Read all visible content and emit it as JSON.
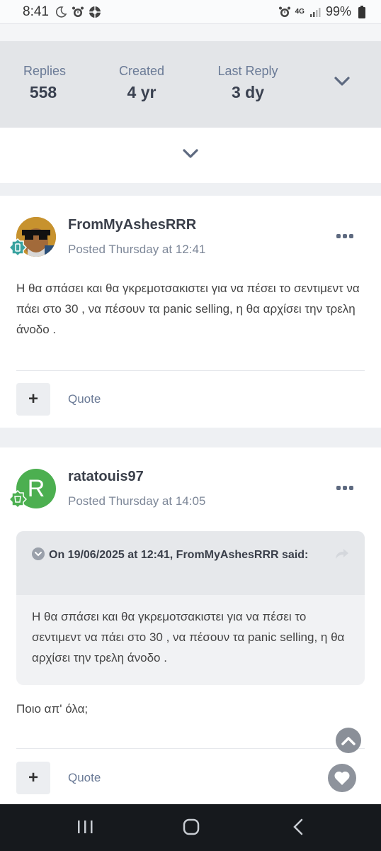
{
  "status_bar": {
    "time": "8:41",
    "battery": "99%",
    "network": "4G"
  },
  "stats": {
    "replies_label": "Replies",
    "replies_value": "558",
    "created_label": "Created",
    "created_value": "4 yr",
    "last_reply_label": "Last Reply",
    "last_reply_value": "3 dy"
  },
  "posts": [
    {
      "author": "FromMyAshesRRR",
      "posted": "Posted Thursday at 12:41",
      "text": "Η θα σπάσει και θα γκρεμοτσακιστει για να πέσει το σεντιμεντ να πάει στο 30 , να πέσουν τα panic selling,  η θα αρχίσει την τρελη άνοδο .",
      "plus": "+",
      "quote": "Quote"
    },
    {
      "author": "ratatouis97",
      "avatar_letter": "R",
      "posted": "Posted Thursday at 14:05",
      "quote_header": "On 19/06/2025 at 12:41, FromMyAshesRRR said:",
      "quote_text": "Η θα σπάσει και θα γκρεμοτσακιστει για να πέσει το σεντιμεντ να πάει στο 30 , να πέσουν τα panic selling, η θα αρχίσει την τρελη άνοδο .",
      "text": "Ποιο απ' όλα;",
      "plus": "+",
      "quote": "Quote"
    }
  ],
  "colors": {
    "accent": "#6a7a96",
    "avatar_green": "#4caf50",
    "badge_teal": "#3aa3a0",
    "nav_bg": "#16191d"
  },
  "icons": [
    "moon-icon",
    "alarm-icon",
    "settings-icon",
    "signal-icon",
    "battery-icon",
    "chevron-down-icon",
    "more-icon",
    "share-icon",
    "scroll-top-icon",
    "heart-icon",
    "recents-icon",
    "home-icon",
    "back-icon"
  ]
}
